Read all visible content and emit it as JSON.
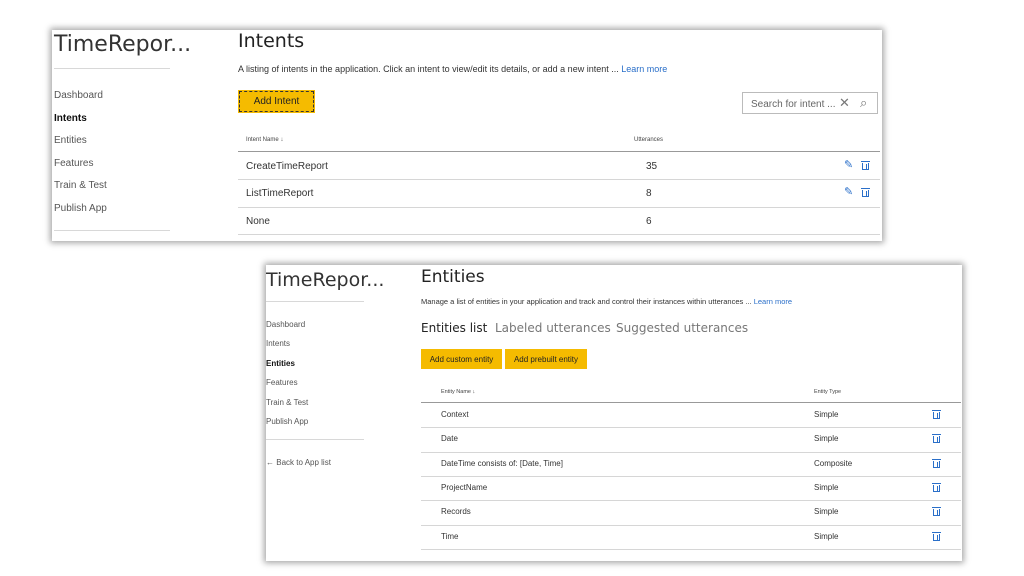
{
  "intents_panel": {
    "app_title": "TimeRepor...",
    "nav": [
      "Dashboard",
      "Intents",
      "Entities",
      "Features",
      "Train & Test",
      "Publish App"
    ],
    "active_nav": "Intents",
    "page_title": "Intents",
    "description": "A listing of intents in the application. Click an intent to view/edit its details, or add a new intent ...",
    "learn_more": "Learn more",
    "add_button": "Add Intent",
    "search_placeholder": "Search for intent ...",
    "columns": {
      "name": "Intent Name ↓",
      "utterances": "Utterances"
    },
    "rows": [
      {
        "name": "CreateTimeReport",
        "utterances": "35",
        "editable": true
      },
      {
        "name": "ListTimeReport",
        "utterances": "8",
        "editable": true
      },
      {
        "name": "None",
        "utterances": "6",
        "editable": false
      }
    ]
  },
  "entities_panel": {
    "app_title": "TimeRepor...",
    "nav": [
      "Dashboard",
      "Intents",
      "Entities",
      "Features",
      "Train & Test",
      "Publish App"
    ],
    "active_nav": "Entities",
    "back_link": "Back to App list",
    "page_title": "Entities",
    "description": "Manage a list of entities in your application and track and control their instances within utterances ...",
    "learn_more": "Learn more",
    "tabs": [
      "Entities list",
      "Labeled utterances",
      "Suggested utterances"
    ],
    "active_tab": "Entities list",
    "buttons": {
      "custom": "Add custom entity",
      "prebuilt": "Add prebuilt entity"
    },
    "columns": {
      "name": "Entity Name ↓",
      "type": "Entity Type"
    },
    "rows": [
      {
        "name": "Context",
        "type": "Simple"
      },
      {
        "name": "Date",
        "type": "Simple"
      },
      {
        "name": "DateTime consists of: [Date, Time]",
        "type": "Composite"
      },
      {
        "name": "ProjectName",
        "type": "Simple"
      },
      {
        "name": "Records",
        "type": "Simple"
      },
      {
        "name": "Time",
        "type": "Simple"
      }
    ]
  },
  "icons": {
    "edit": "pencil-icon",
    "delete": "trash-icon",
    "clear": "close-icon",
    "search": "search-icon",
    "back": "arrow-left-icon",
    "sort": "arrow-down-icon"
  },
  "colors": {
    "accent_button": "#f5bb00",
    "link": "#2a6fc9"
  }
}
